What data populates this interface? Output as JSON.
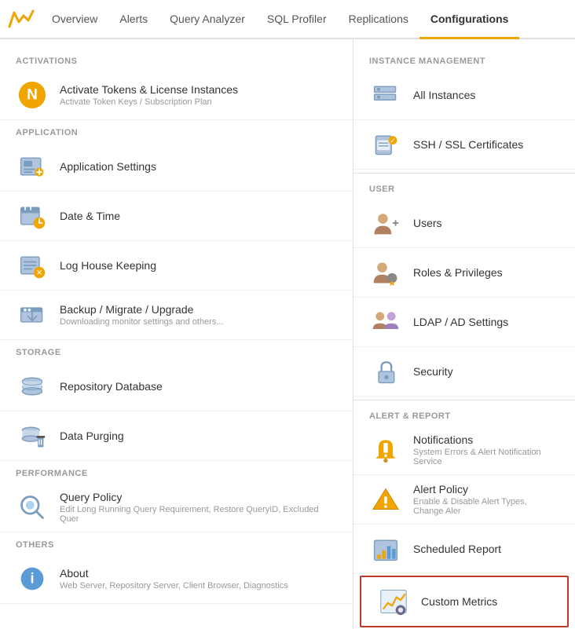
{
  "nav": {
    "tabs": [
      {
        "id": "overview",
        "label": "Overview",
        "active": false
      },
      {
        "id": "alerts",
        "label": "Alerts",
        "active": false
      },
      {
        "id": "query-analyzer",
        "label": "Query Analyzer",
        "active": false
      },
      {
        "id": "sql-profiler",
        "label": "SQL Profiler",
        "active": false
      },
      {
        "id": "replications",
        "label": "Replications",
        "active": false
      },
      {
        "id": "configurations",
        "label": "Configurations",
        "active": true
      }
    ]
  },
  "left": {
    "sections": [
      {
        "id": "activations",
        "header": "ACTIVATIONS",
        "items": [
          {
            "id": "activate-tokens",
            "title": "Activate Tokens & License Instances",
            "subtitle": "Activate Token Keys / Subscription Plan",
            "icon": "token"
          }
        ]
      },
      {
        "id": "application",
        "header": "APPLICATION",
        "items": [
          {
            "id": "app-settings",
            "title": "Application Settings",
            "subtitle": "",
            "icon": "app-settings"
          },
          {
            "id": "date-time",
            "title": "Date & Time",
            "subtitle": "",
            "icon": "date-time"
          },
          {
            "id": "log-housekeeping",
            "title": "Log House Keeping",
            "subtitle": "",
            "icon": "log"
          },
          {
            "id": "backup-migrate",
            "title": "Backup / Migrate / Upgrade",
            "subtitle": "Downloading monitor settings and others...",
            "icon": "backup"
          }
        ]
      },
      {
        "id": "storage",
        "header": "STORAGE",
        "items": [
          {
            "id": "repository-db",
            "title": "Repository Database",
            "subtitle": "",
            "icon": "repository"
          },
          {
            "id": "data-purging",
            "title": "Data Purging",
            "subtitle": "",
            "icon": "purge"
          }
        ]
      },
      {
        "id": "performance",
        "header": "PERFORMANCE",
        "items": [
          {
            "id": "query-policy",
            "title": "Query Policy",
            "subtitle": "Edit Long Running Query Requirement, Restore QueryID, Excluded Quer",
            "icon": "query"
          }
        ]
      },
      {
        "id": "others",
        "header": "OTHERS",
        "items": [
          {
            "id": "about",
            "title": "About",
            "subtitle": "Web Server, Repository Server, Client Browser, Diagnostics",
            "icon": "info"
          }
        ]
      }
    ]
  },
  "right": {
    "sections": [
      {
        "id": "instance-management",
        "header": "INSTANCE MANAGEMENT",
        "items": [
          {
            "id": "all-instances",
            "title": "All Instances",
            "subtitle": "",
            "icon": "instances",
            "highlighted": false
          },
          {
            "id": "ssh-ssl",
            "title": "SSH / SSL Certificates",
            "subtitle": "",
            "icon": "ssl",
            "highlighted": false
          }
        ]
      },
      {
        "id": "user",
        "header": "USER",
        "items": [
          {
            "id": "users",
            "title": "Users",
            "subtitle": "",
            "icon": "users",
            "highlighted": false
          },
          {
            "id": "roles-privileges",
            "title": "Roles & Privileges",
            "subtitle": "",
            "icon": "roles",
            "highlighted": false
          },
          {
            "id": "ldap-ad",
            "title": "LDAP / AD Settings",
            "subtitle": "",
            "icon": "ldap",
            "highlighted": false
          },
          {
            "id": "security",
            "title": "Security",
            "subtitle": "",
            "icon": "security",
            "highlighted": false
          }
        ]
      },
      {
        "id": "alert-report",
        "header": "ALERT & REPORT",
        "items": [
          {
            "id": "notifications",
            "title": "Notifications",
            "subtitle": "System Errors & Alert Notification Service",
            "icon": "notifications",
            "highlighted": false
          },
          {
            "id": "alert-policy",
            "title": "Alert Policy",
            "subtitle": "Enable & Disable Alert Types, Change Aler",
            "icon": "alert-policy",
            "highlighted": false
          },
          {
            "id": "scheduled-report",
            "title": "Scheduled Report",
            "subtitle": "",
            "icon": "scheduled-report",
            "highlighted": false
          },
          {
            "id": "custom-metrics",
            "title": "Custom Metrics",
            "subtitle": "",
            "icon": "custom-metrics",
            "highlighted": true
          }
        ]
      }
    ]
  }
}
